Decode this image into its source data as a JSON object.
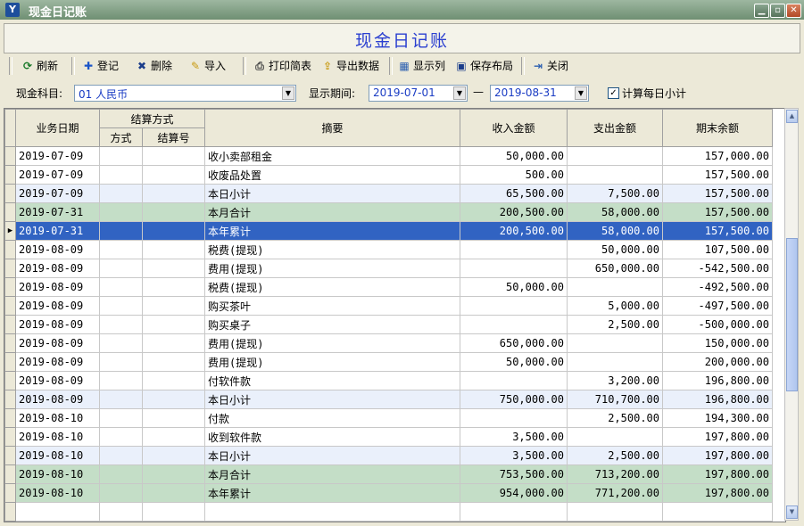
{
  "window": {
    "title": "现金日记账",
    "app_icon": "Y"
  },
  "banner": {
    "title": "现金日记账"
  },
  "toolbar": {
    "refresh": "刷新",
    "register": "登记",
    "delete": "删除",
    "import": "导入",
    "print": "打印简表",
    "export": "导出数据",
    "columns": "显示列",
    "save_layout": "保存布局",
    "close": "关闭"
  },
  "filter": {
    "subject_label": "现金科目:",
    "subject_value": "01 人民币",
    "period_label": "显示期间:",
    "date_from": "2019-07-01",
    "dash": "—",
    "date_to": "2019-08-31",
    "daily_subtotal_label": "计算每日小计",
    "daily_subtotal_checked": true
  },
  "grid": {
    "headers": {
      "date": "业务日期",
      "settlement": "结算方式",
      "method": "方式",
      "number": "结算号",
      "summary": "摘要",
      "income": "收入金额",
      "expense": "支出金额",
      "balance": "期末余额"
    },
    "rows": [
      {
        "date": "2019-07-09",
        "summary": "收小卖部租金",
        "income": "50,000.00",
        "expense": "",
        "balance": "157,000.00",
        "kind": "normal"
      },
      {
        "date": "2019-07-09",
        "summary": "收废品处置",
        "income": "500.00",
        "expense": "",
        "balance": "157,500.00",
        "kind": "normal"
      },
      {
        "date": "2019-07-09",
        "summary": "本日小计",
        "income": "65,500.00",
        "expense": "7,500.00",
        "balance": "157,500.00",
        "kind": "daily"
      },
      {
        "date": "2019-07-31",
        "summary": "本月合计",
        "income": "200,500.00",
        "expense": "58,000.00",
        "balance": "157,500.00",
        "kind": "month"
      },
      {
        "date": "2019-07-31",
        "summary": "本年累计",
        "income": "200,500.00",
        "expense": "58,000.00",
        "balance": "157,500.00",
        "kind": "sel"
      },
      {
        "date": "2019-08-09",
        "summary": "税费(提现)",
        "income": "",
        "expense": "50,000.00",
        "balance": "107,500.00",
        "kind": "normal"
      },
      {
        "date": "2019-08-09",
        "summary": "费用(提现)",
        "income": "",
        "expense": "650,000.00",
        "balance": "-542,500.00",
        "kind": "normal"
      },
      {
        "date": "2019-08-09",
        "summary": "税费(提现)",
        "income": "50,000.00",
        "expense": "",
        "balance": "-492,500.00",
        "kind": "normal"
      },
      {
        "date": "2019-08-09",
        "summary": "购买茶叶",
        "income": "",
        "expense": "5,000.00",
        "balance": "-497,500.00",
        "kind": "normal"
      },
      {
        "date": "2019-08-09",
        "summary": "购买桌子",
        "income": "",
        "expense": "2,500.00",
        "balance": "-500,000.00",
        "kind": "normal"
      },
      {
        "date": "2019-08-09",
        "summary": "费用(提现)",
        "income": "650,000.00",
        "expense": "",
        "balance": "150,000.00",
        "kind": "normal"
      },
      {
        "date": "2019-08-09",
        "summary": "费用(提现)",
        "income": "50,000.00",
        "expense": "",
        "balance": "200,000.00",
        "kind": "normal"
      },
      {
        "date": "2019-08-09",
        "summary": "付软件款",
        "income": "",
        "expense": "3,200.00",
        "balance": "196,800.00",
        "kind": "normal"
      },
      {
        "date": "2019-08-09",
        "summary": "本日小计",
        "income": "750,000.00",
        "expense": "710,700.00",
        "balance": "196,800.00",
        "kind": "daily"
      },
      {
        "date": "2019-08-10",
        "summary": "付款",
        "income": "",
        "expense": "2,500.00",
        "balance": "194,300.00",
        "kind": "normal"
      },
      {
        "date": "2019-08-10",
        "summary": "收到软件款",
        "income": "3,500.00",
        "expense": "",
        "balance": "197,800.00",
        "kind": "normal"
      },
      {
        "date": "2019-08-10",
        "summary": "本日小计",
        "income": "3,500.00",
        "expense": "2,500.00",
        "balance": "197,800.00",
        "kind": "daily"
      },
      {
        "date": "2019-08-10",
        "summary": "本月合计",
        "income": "753,500.00",
        "expense": "713,200.00",
        "balance": "197,800.00",
        "kind": "month"
      },
      {
        "date": "2019-08-10",
        "summary": "本年累计",
        "income": "954,000.00",
        "expense": "771,200.00",
        "balance": "197,800.00",
        "kind": "year"
      }
    ]
  }
}
